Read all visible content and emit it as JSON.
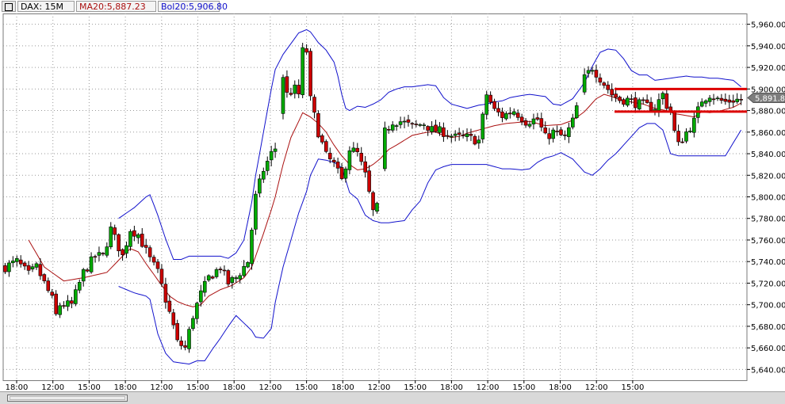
{
  "header": {
    "title": "DAX: 15M",
    "ma_label": "MA20:5,887.23",
    "bol_label": "Bol20:5,906.80"
  },
  "colors": {
    "up_candle": "#00aa00",
    "down_candle": "#cc0000",
    "ma_line": "#aa1111",
    "bollinger": "#1111cc",
    "level_lines": "#dd0000",
    "grid": "#9a9a9a"
  },
  "chart_data": {
    "type": "candlestick",
    "ylim": [
      5630,
      5970
    ],
    "y_ticks": [
      "5,640.00",
      "5,660.00",
      "5,680.00",
      "5,700.00",
      "5,720.00",
      "5,740.00",
      "5,760.00",
      "5,780.00",
      "5,800.00",
      "5,820.00",
      "5,840.00",
      "5,860.00",
      "5,880.00",
      "5,900.00",
      "5,920.00",
      "5,940.00",
      "5,960.00"
    ],
    "x_ticks": [
      "18:00",
      "12:00",
      "15:00",
      "18:00",
      "12:00",
      "15:00",
      "18:00",
      "12:00",
      "15:00",
      "18:00",
      "12:00",
      "15:00",
      "18:00",
      "12:00",
      "15:00",
      "18:00",
      "12:00",
      "15:00"
    ],
    "last_price": "5,891.81",
    "horizontal_levels": [
      5900,
      5879
    ],
    "close_path": [
      [
        0,
        5735
      ],
      [
        3,
        5740
      ],
      [
        6,
        5728
      ],
      [
        8,
        5735
      ],
      [
        10,
        5720
      ],
      [
        12,
        5705
      ],
      [
        13,
        5690
      ],
      [
        14,
        5700
      ],
      [
        17,
        5700
      ],
      [
        20,
        5730
      ],
      [
        23,
        5745
      ],
      [
        25,
        5745
      ],
      [
        27,
        5770
      ],
      [
        30,
        5745
      ],
      [
        32,
        5770
      ],
      [
        34,
        5765
      ],
      [
        37,
        5742
      ],
      [
        39,
        5730
      ],
      [
        41,
        5705
      ],
      [
        43,
        5680
      ],
      [
        44,
        5665
      ],
      [
        46,
        5660
      ],
      [
        48,
        5690
      ],
      [
        50,
        5710
      ],
      [
        52,
        5725
      ],
      [
        55,
        5735
      ],
      [
        57,
        5720
      ],
      [
        59,
        5725
      ],
      [
        62,
        5740
      ],
      [
        63,
        5770
      ],
      [
        64,
        5800
      ],
      [
        66,
        5825
      ],
      [
        68,
        5840
      ],
      [
        69,
        5845
      ],
      [
        71,
        5912
      ],
      [
        72,
        5895
      ],
      [
        74,
        5900
      ],
      [
        75,
        5895
      ],
      [
        76,
        5935
      ],
      [
        77,
        5935
      ],
      [
        78,
        5890
      ],
      [
        80,
        5860
      ],
      [
        82,
        5838
      ],
      [
        84,
        5830
      ],
      [
        86,
        5815
      ],
      [
        88,
        5845
      ],
      [
        90,
        5840
      ],
      [
        92,
        5820
      ],
      [
        94,
        5786
      ],
      [
        95,
        5790
      ],
      [
        97,
        5860
      ],
      [
        99,
        5870
      ],
      [
        101,
        5870
      ],
      [
        104,
        5865
      ],
      [
        107,
        5868
      ],
      [
        109,
        5862
      ],
      [
        112,
        5860
      ],
      [
        115,
        5855
      ],
      [
        118,
        5855
      ],
      [
        121,
        5852
      ],
      [
        123,
        5895
      ],
      [
        125,
        5880
      ],
      [
        127,
        5875
      ],
      [
        130,
        5880
      ],
      [
        133,
        5870
      ],
      [
        136,
        5872
      ],
      [
        138,
        5855
      ],
      [
        140,
        5860
      ],
      [
        143,
        5855
      ],
      [
        145,
        5870
      ],
      [
        148,
        5910
      ],
      [
        150,
        5920
      ],
      [
        152,
        5910
      ],
      [
        155,
        5895
      ],
      [
        157,
        5890
      ],
      [
        159,
        5890
      ],
      [
        161,
        5887
      ],
      [
        163,
        5885
      ],
      [
        166,
        5883
      ],
      [
        168,
        5895
      ],
      [
        169,
        5885
      ],
      [
        170,
        5880
      ],
      [
        171,
        5860
      ],
      [
        172,
        5848
      ],
      [
        174,
        5860
      ],
      [
        176,
        5870
      ],
      [
        178,
        5890
      ],
      [
        180,
        5895
      ],
      [
        182,
        5890
      ],
      [
        184,
        5888
      ],
      [
        186,
        5890
      ],
      [
        188,
        5890
      ]
    ],
    "ma20_path": [
      [
        6,
        5760
      ],
      [
        10,
        5735
      ],
      [
        15,
        5722
      ],
      [
        20,
        5725
      ],
      [
        26,
        5730
      ],
      [
        30,
        5745
      ],
      [
        32,
        5752
      ],
      [
        34,
        5749
      ],
      [
        36,
        5738
      ],
      [
        38,
        5728
      ],
      [
        40,
        5718
      ],
      [
        42,
        5708
      ],
      [
        44,
        5703
      ],
      [
        46,
        5700
      ],
      [
        48,
        5698
      ],
      [
        50,
        5700
      ],
      [
        52,
        5708
      ],
      [
        55,
        5714
      ],
      [
        58,
        5718
      ],
      [
        61,
        5725
      ],
      [
        63,
        5735
      ],
      [
        64,
        5745
      ],
      [
        66,
        5766
      ],
      [
        68,
        5788
      ],
      [
        69,
        5800
      ],
      [
        71,
        5830
      ],
      [
        73,
        5855
      ],
      [
        75,
        5870
      ],
      [
        76,
        5878
      ],
      [
        78,
        5874
      ],
      [
        80,
        5868
      ],
      [
        82,
        5860
      ],
      [
        84,
        5848
      ],
      [
        86,
        5838
      ],
      [
        88,
        5830
      ],
      [
        90,
        5825
      ],
      [
        92,
        5826
      ],
      [
        94,
        5830
      ],
      [
        96,
        5836
      ],
      [
        98,
        5844
      ],
      [
        100,
        5848
      ],
      [
        104,
        5857
      ],
      [
        108,
        5860
      ],
      [
        110,
        5860
      ],
      [
        112,
        5857
      ],
      [
        114,
        5855
      ],
      [
        116,
        5856
      ],
      [
        118,
        5859
      ],
      [
        120,
        5861
      ],
      [
        122,
        5863
      ],
      [
        125,
        5866
      ],
      [
        128,
        5868
      ],
      [
        131,
        5869
      ],
      [
        134,
        5870
      ],
      [
        138,
        5866
      ],
      [
        142,
        5867
      ],
      [
        145,
        5871
      ],
      [
        148,
        5879
      ],
      [
        151,
        5891
      ],
      [
        153,
        5895
      ],
      [
        155,
        5893
      ],
      [
        157,
        5890
      ],
      [
        160,
        5888
      ],
      [
        163,
        5886
      ],
      [
        166,
        5882
      ],
      [
        169,
        5880
      ],
      [
        171,
        5877
      ],
      [
        173,
        5876
      ],
      [
        176,
        5874
      ],
      [
        178,
        5879
      ],
      [
        180,
        5878
      ],
      [
        183,
        5880
      ],
      [
        186,
        5883
      ],
      [
        188,
        5887
      ]
    ],
    "bol_upper_path": [
      [
        29,
        5780
      ],
      [
        33,
        5790
      ],
      [
        36,
        5800
      ],
      [
        37,
        5802
      ],
      [
        39,
        5783
      ],
      [
        41,
        5761
      ],
      [
        43,
        5742
      ],
      [
        45,
        5742
      ],
      [
        47,
        5745
      ],
      [
        49,
        5745
      ],
      [
        51,
        5745
      ],
      [
        53,
        5745
      ],
      [
        55,
        5745
      ],
      [
        57,
        5743
      ],
      [
        59,
        5748
      ],
      [
        61,
        5760
      ],
      [
        63,
        5795
      ],
      [
        64,
        5820
      ],
      [
        66,
        5860
      ],
      [
        68,
        5900
      ],
      [
        69,
        5918
      ],
      [
        71,
        5932
      ],
      [
        73,
        5942
      ],
      [
        75,
        5952
      ],
      [
        77,
        5955
      ],
      [
        78,
        5953
      ],
      [
        80,
        5943
      ],
      [
        82,
        5936
      ],
      [
        84,
        5925
      ],
      [
        85,
        5912
      ],
      [
        86,
        5895
      ],
      [
        87,
        5882
      ],
      [
        88,
        5880
      ],
      [
        90,
        5884
      ],
      [
        92,
        5883
      ],
      [
        94,
        5886
      ],
      [
        96,
        5890
      ],
      [
        98,
        5897
      ],
      [
        100,
        5900
      ],
      [
        102,
        5902
      ],
      [
        104,
        5902
      ],
      [
        106,
        5903
      ],
      [
        108,
        5904
      ],
      [
        110,
        5903
      ],
      [
        112,
        5892
      ],
      [
        114,
        5886
      ],
      [
        118,
        5882
      ],
      [
        121,
        5885
      ],
      [
        123,
        5886
      ],
      [
        125,
        5888
      ],
      [
        127,
        5889
      ],
      [
        129,
        5892
      ],
      [
        132,
        5894
      ],
      [
        134,
        5895
      ],
      [
        136,
        5894
      ],
      [
        138,
        5893
      ],
      [
        140,
        5886
      ],
      [
        142,
        5885
      ],
      [
        145,
        5891
      ],
      [
        148,
        5906
      ],
      [
        150,
        5921
      ],
      [
        152,
        5934
      ],
      [
        154,
        5937
      ],
      [
        156,
        5936
      ],
      [
        158,
        5928
      ],
      [
        160,
        5917
      ],
      [
        162,
        5913
      ],
      [
        164,
        5913
      ],
      [
        166,
        5908
      ],
      [
        168,
        5909
      ],
      [
        170,
        5910
      ],
      [
        172,
        5911
      ],
      [
        174,
        5912
      ],
      [
        176,
        5911
      ],
      [
        178,
        5911
      ],
      [
        180,
        5910
      ],
      [
        182,
        5910
      ],
      [
        186,
        5908
      ],
      [
        188,
        5902
      ]
    ],
    "bol_lower_path": [
      [
        29,
        5717
      ],
      [
        33,
        5711
      ],
      [
        36,
        5708
      ],
      [
        37,
        5705
      ],
      [
        39,
        5673
      ],
      [
        41,
        5655
      ],
      [
        43,
        5647
      ],
      [
        45,
        5646
      ],
      [
        47,
        5645
      ],
      [
        49,
        5648
      ],
      [
        51,
        5648
      ],
      [
        53,
        5659
      ],
      [
        55,
        5669
      ],
      [
        57,
        5680
      ],
      [
        59,
        5690
      ],
      [
        61,
        5683
      ],
      [
        63,
        5676
      ],
      [
        64,
        5670
      ],
      [
        66,
        5669
      ],
      [
        68,
        5678
      ],
      [
        69,
        5702
      ],
      [
        71,
        5735
      ],
      [
        73,
        5760
      ],
      [
        75,
        5785
      ],
      [
        77,
        5805
      ],
      [
        78,
        5820
      ],
      [
        80,
        5835
      ],
      [
        82,
        5834
      ],
      [
        84,
        5832
      ],
      [
        86,
        5827
      ],
      [
        88,
        5804
      ],
      [
        90,
        5798
      ],
      [
        92,
        5783
      ],
      [
        94,
        5778
      ],
      [
        96,
        5776
      ],
      [
        98,
        5776
      ],
      [
        100,
        5777
      ],
      [
        102,
        5778
      ],
      [
        104,
        5788
      ],
      [
        106,
        5796
      ],
      [
        108,
        5813
      ],
      [
        110,
        5825
      ],
      [
        112,
        5828
      ],
      [
        114,
        5830
      ],
      [
        118,
        5830
      ],
      [
        121,
        5830
      ],
      [
        123,
        5830
      ],
      [
        125,
        5828
      ],
      [
        127,
        5826
      ],
      [
        129,
        5826
      ],
      [
        132,
        5825
      ],
      [
        134,
        5826
      ],
      [
        136,
        5832
      ],
      [
        138,
        5836
      ],
      [
        140,
        5838
      ],
      [
        142,
        5841
      ],
      [
        145,
        5835
      ],
      [
        148,
        5823
      ],
      [
        150,
        5820
      ],
      [
        152,
        5826
      ],
      [
        154,
        5834
      ],
      [
        156,
        5840
      ],
      [
        158,
        5848
      ],
      [
        160,
        5856
      ],
      [
        162,
        5864
      ],
      [
        164,
        5868
      ],
      [
        166,
        5868
      ],
      [
        168,
        5862
      ],
      [
        170,
        5840
      ],
      [
        172,
        5838
      ],
      [
        174,
        5838
      ],
      [
        176,
        5838
      ],
      [
        178,
        5838
      ],
      [
        180,
        5838
      ],
      [
        182,
        5838
      ],
      [
        184,
        5838
      ],
      [
        186,
        5850
      ],
      [
        188,
        5862
      ]
    ]
  }
}
